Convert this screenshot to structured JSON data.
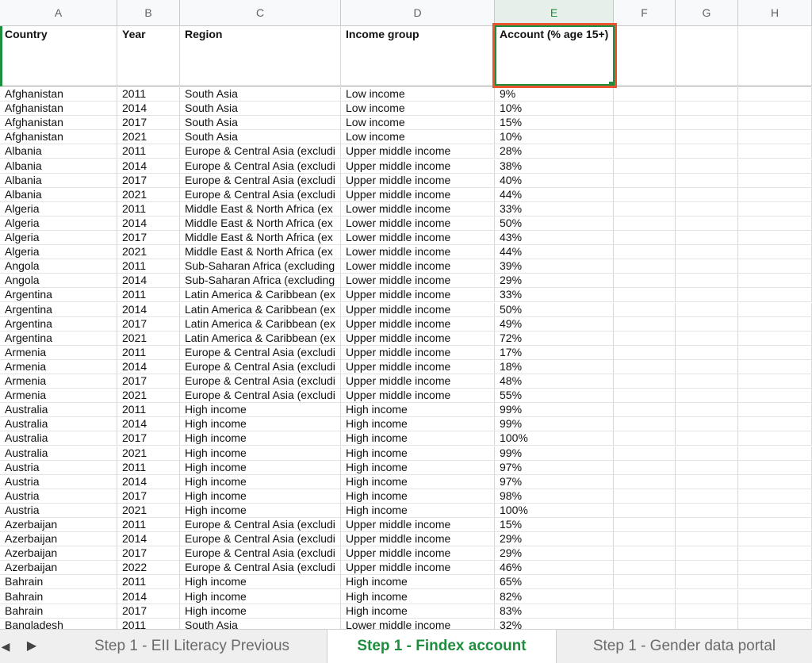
{
  "columns": [
    "A",
    "B",
    "C",
    "D",
    "E",
    "F",
    "G",
    "H"
  ],
  "header": {
    "country": "Country",
    "year": "Year",
    "region": "Region",
    "income": "Income group",
    "account": "Account (% age 15+)"
  },
  "rows": [
    [
      "Afghanistan",
      "2011",
      "South Asia",
      "Low income",
      "9%"
    ],
    [
      "Afghanistan",
      "2014",
      "South Asia",
      "Low income",
      "10%"
    ],
    [
      "Afghanistan",
      "2017",
      "South Asia",
      "Low income",
      "15%"
    ],
    [
      "Afghanistan",
      "2021",
      "South Asia",
      "Low income",
      "10%"
    ],
    [
      "Albania",
      "2011",
      "Europe & Central Asia (excludi",
      "Upper middle income",
      "28%"
    ],
    [
      "Albania",
      "2014",
      "Europe & Central Asia (excludi",
      "Upper middle income",
      "38%"
    ],
    [
      "Albania",
      "2017",
      "Europe & Central Asia (excludi",
      "Upper middle income",
      "40%"
    ],
    [
      "Albania",
      "2021",
      "Europe & Central Asia (excludi",
      "Upper middle income",
      "44%"
    ],
    [
      "Algeria",
      "2011",
      "Middle East & North Africa (ex",
      "Lower middle income",
      "33%"
    ],
    [
      "Algeria",
      "2014",
      "Middle East & North Africa (ex",
      "Lower middle income",
      "50%"
    ],
    [
      "Algeria",
      "2017",
      "Middle East & North Africa (ex",
      "Lower middle income",
      "43%"
    ],
    [
      "Algeria",
      "2021",
      "Middle East & North Africa (ex",
      "Lower middle income",
      "44%"
    ],
    [
      "Angola",
      "2011",
      "Sub-Saharan Africa (excluding",
      "Lower middle income",
      "39%"
    ],
    [
      "Angola",
      "2014",
      "Sub-Saharan Africa (excluding",
      "Lower middle income",
      "29%"
    ],
    [
      "Argentina",
      "2011",
      "Latin America & Caribbean (ex",
      "Upper middle income",
      "33%"
    ],
    [
      "Argentina",
      "2014",
      "Latin America & Caribbean (ex",
      "Upper middle income",
      "50%"
    ],
    [
      "Argentina",
      "2017",
      "Latin America & Caribbean (ex",
      "Upper middle income",
      "49%"
    ],
    [
      "Argentina",
      "2021",
      "Latin America & Caribbean (ex",
      "Upper middle income",
      "72%"
    ],
    [
      "Armenia",
      "2011",
      "Europe & Central Asia (excludi",
      "Upper middle income",
      "17%"
    ],
    [
      "Armenia",
      "2014",
      "Europe & Central Asia (excludi",
      "Upper middle income",
      "18%"
    ],
    [
      "Armenia",
      "2017",
      "Europe & Central Asia (excludi",
      "Upper middle income",
      "48%"
    ],
    [
      "Armenia",
      "2021",
      "Europe & Central Asia (excludi",
      "Upper middle income",
      "55%"
    ],
    [
      "Australia",
      "2011",
      "High income",
      "High income",
      "99%"
    ],
    [
      "Australia",
      "2014",
      "High income",
      "High income",
      "99%"
    ],
    [
      "Australia",
      "2017",
      "High income",
      "High income",
      "100%"
    ],
    [
      "Australia",
      "2021",
      "High income",
      "High income",
      "99%"
    ],
    [
      "Austria",
      "2011",
      "High income",
      "High income",
      "97%"
    ],
    [
      "Austria",
      "2014",
      "High income",
      "High income",
      "97%"
    ],
    [
      "Austria",
      "2017",
      "High income",
      "High income",
      "98%"
    ],
    [
      "Austria",
      "2021",
      "High income",
      "High income",
      "100%"
    ],
    [
      "Azerbaijan",
      "2011",
      "Europe & Central Asia (excludi",
      "Upper middle income",
      "15%"
    ],
    [
      "Azerbaijan",
      "2014",
      "Europe & Central Asia (excludi",
      "Upper middle income",
      "29%"
    ],
    [
      "Azerbaijan",
      "2017",
      "Europe & Central Asia (excludi",
      "Upper middle income",
      "29%"
    ],
    [
      "Azerbaijan",
      "2022",
      "Europe & Central Asia (excludi",
      "Upper middle income",
      "46%"
    ],
    [
      "Bahrain",
      "2011",
      "High income",
      "High income",
      "65%"
    ],
    [
      "Bahrain",
      "2014",
      "High income",
      "High income",
      "82%"
    ],
    [
      "Bahrain",
      "2017",
      "High income",
      "High income",
      "83%"
    ],
    [
      "Bangladesh",
      "2011",
      "South Asia",
      "Lower middle income",
      "32%"
    ]
  ],
  "tabs": {
    "prev_arrow": "◀",
    "next_arrow": "▶",
    "items": [
      {
        "label": "Step 1 - EII Literacy Previous",
        "active": false
      },
      {
        "label": "Step 1 - Findex account",
        "active": true
      },
      {
        "label": "Step 1 - Gender data portal",
        "active": false
      }
    ]
  },
  "colors": {
    "accent": "#1e8e3e",
    "highlight": "#e8542f"
  }
}
